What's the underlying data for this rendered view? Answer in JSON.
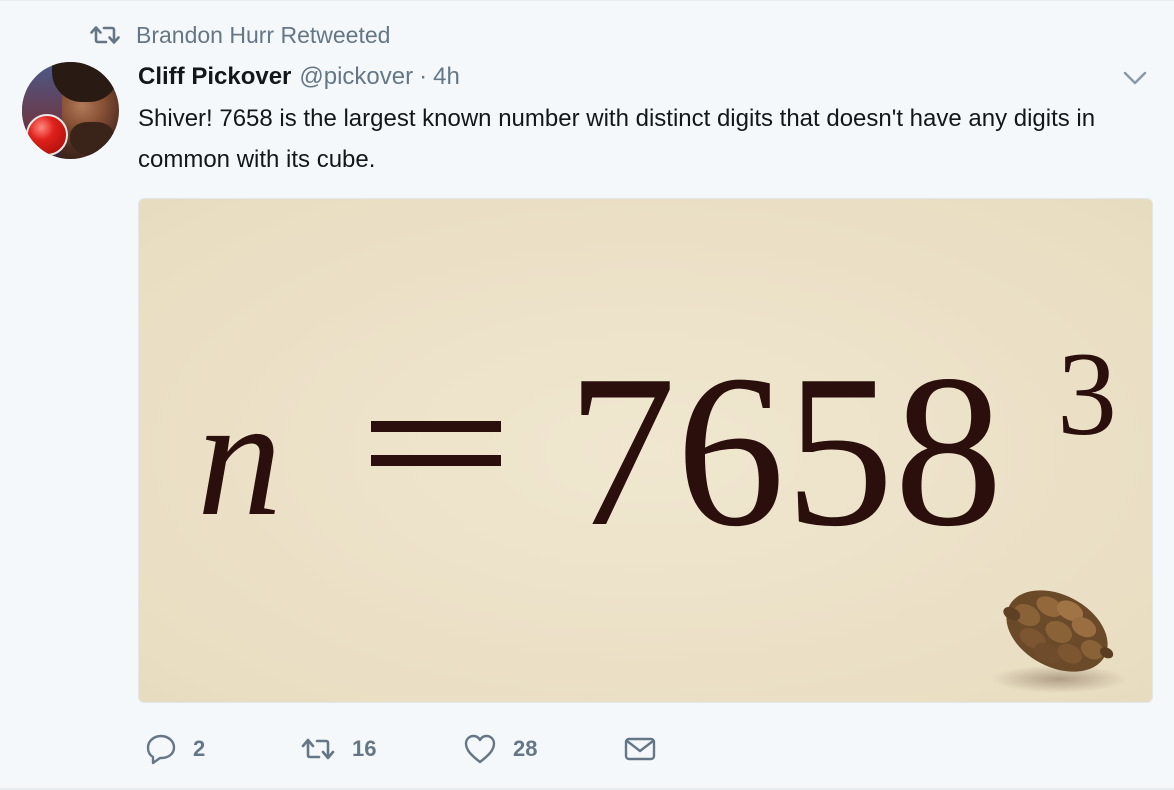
{
  "retweet_context": {
    "icon": "retweet-icon",
    "text": "Brandon Hurr Retweeted"
  },
  "tweet": {
    "author_name": "Cliff Pickover",
    "author_handle": "@pickover",
    "separator": "·",
    "timestamp": "4h",
    "text": "Shiver! 7658 is the largest known number with distinct digits that doesn't have any digits in common with its cube.",
    "media": {
      "variable": "n",
      "equals": "=",
      "base": "7658",
      "exponent": "3",
      "background_color": "#ede3ca",
      "ink_color": "#2a0f0c"
    }
  },
  "actions": {
    "reply_count": "2",
    "retweet_count": "16",
    "like_count": "28"
  },
  "icons": {
    "caret": "chevron-down-icon",
    "reply": "reply-icon",
    "retweet": "retweet-icon",
    "like": "heart-icon",
    "dm": "envelope-icon"
  }
}
